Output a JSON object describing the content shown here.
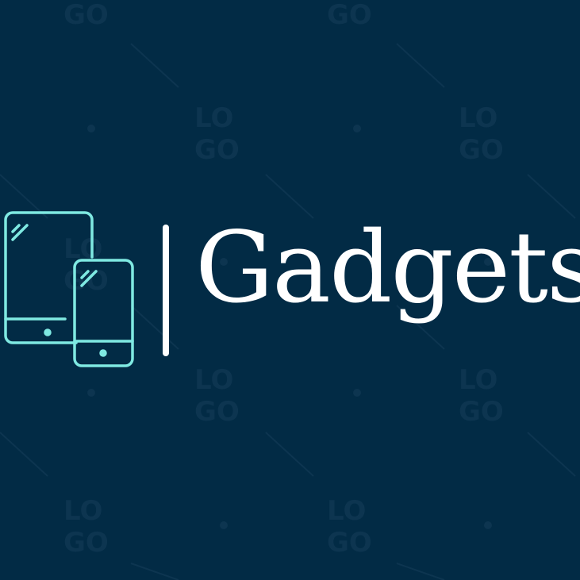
{
  "logo": {
    "brand_name": "Gadgets",
    "icon": "tablet-and-phone-icon",
    "watermark_text": "LOGO"
  },
  "colors": {
    "background": "#022b45",
    "icon_stroke": "#7fe9e2",
    "text": "#ffffff",
    "watermark": "#0f3a54"
  }
}
